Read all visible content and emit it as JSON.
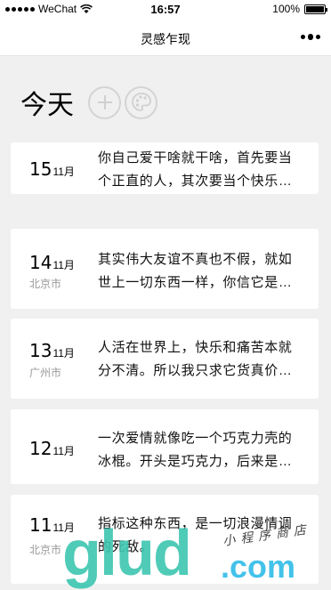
{
  "statusbar": {
    "carrier": "WeChat",
    "time": "16:57",
    "battery": "100%",
    "battery_level": 1.0
  },
  "navbar": {
    "title": "灵感乍现"
  },
  "header": {
    "title": "今天",
    "add_icon": "plus-circle-icon",
    "theme_icon": "palette-circle-icon"
  },
  "entries": [
    {
      "day": "15",
      "month": "11月",
      "city": "",
      "text": "你自己爱干啥就干啥，首先要当个正直的人，其次要当个快乐的人。"
    },
    {
      "day": "14",
      "month": "11月",
      "city": "北京市",
      "text": "其实伟大友谊不真也不假，就如世上一切东西一样，你信它是真的就是真的。"
    },
    {
      "day": "13",
      "month": "11月",
      "city": "广州市",
      "text": "人活在世界上，快乐和痛苦本就分不清。所以我只求它货真价实。"
    },
    {
      "day": "12",
      "month": "11月",
      "city": "",
      "text": "一次爱情就像吃一个巧克力壳的冰棍。开头是巧克力，后来是冰。"
    },
    {
      "day": "11",
      "month": "11月",
      "city": "北京市",
      "text": "指标这种东西，是一切浪漫情调的死敌。"
    }
  ],
  "watermark": {
    "big": "glud",
    "com": ".com",
    "small": "小程序商店"
  }
}
